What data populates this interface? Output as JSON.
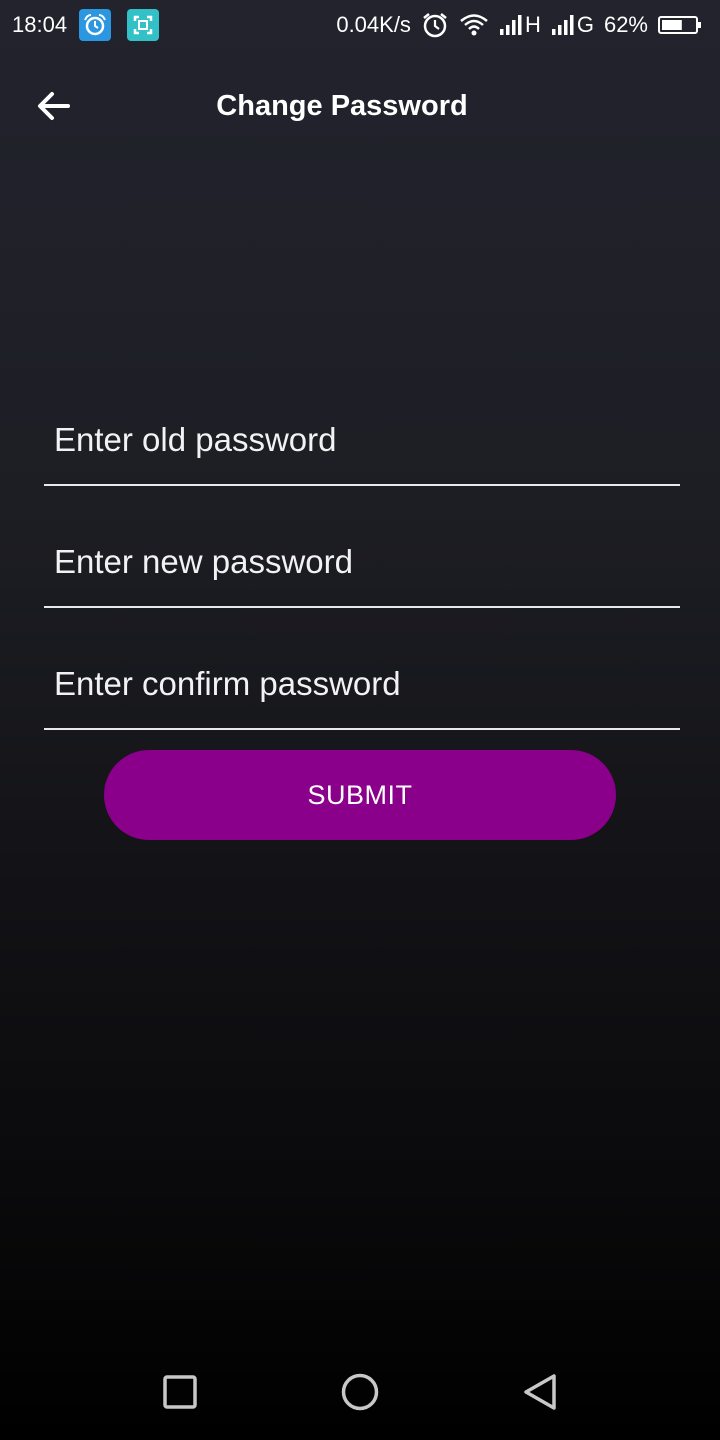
{
  "status_bar": {
    "time": "18:04",
    "net_speed": "0.04K/s",
    "net_type_1": "H",
    "net_type_2": "G",
    "battery": "62%",
    "battery_level": 0.62,
    "icons": [
      "app-notification-icon",
      "screenshot-app-icon",
      "alarm-icon",
      "wifi-icon",
      "signal-icon",
      "battery-icon"
    ]
  },
  "header": {
    "title": "Change Password",
    "back_icon": "arrow-left-icon"
  },
  "form": {
    "old_password_placeholder": "Enter old password",
    "new_password_placeholder": "Enter new password",
    "confirm_password_placeholder": "Enter confirm password",
    "old_password_value": "",
    "new_password_value": "",
    "confirm_password_value": "",
    "submit_label": "SUBMIT"
  },
  "nav_bar": {
    "icons": [
      "recents-icon",
      "home-icon",
      "back-icon"
    ]
  },
  "colors": {
    "accent": "#8b008b",
    "text": "#ffffff",
    "underline": "#e8e8ea"
  }
}
